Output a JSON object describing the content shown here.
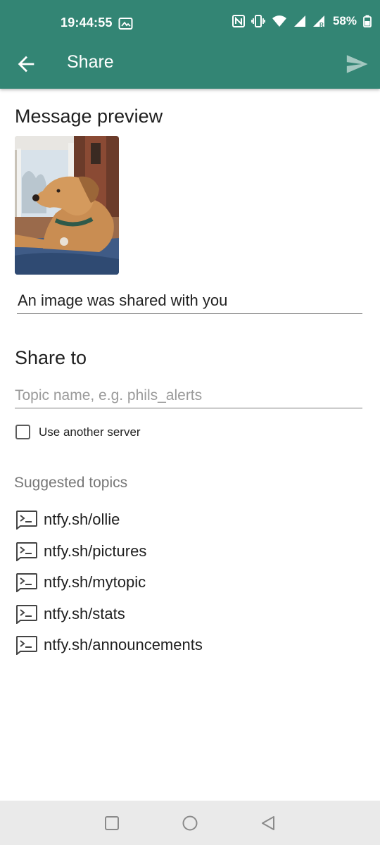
{
  "status_bar": {
    "time": "19:44:55",
    "battery": "58%",
    "icons": [
      "gallery-icon",
      "nfc-icon",
      "vibrate-icon",
      "wifi-icon",
      "signal-icon",
      "signal-roaming-icon",
      "battery-icon"
    ]
  },
  "app_bar": {
    "title": "Share",
    "back_icon": "arrow-back-icon",
    "send_icon": "send-icon",
    "background": "#338574"
  },
  "message_preview": {
    "heading": "Message preview",
    "image": "shared dog photo",
    "message": "An image was shared with you"
  },
  "share_to": {
    "heading": "Share to",
    "topic_placeholder": "Topic name, e.g. phils_alerts",
    "use_another_server_label": "Use another server",
    "use_another_server_checked": false
  },
  "suggested": {
    "heading": "Suggested topics",
    "topics": [
      {
        "label": "ntfy.sh/ollie",
        "icon": "terminal-icon"
      },
      {
        "label": "ntfy.sh/pictures",
        "icon": "terminal-icon"
      },
      {
        "label": "ntfy.sh/mytopic",
        "icon": "terminal-icon"
      },
      {
        "label": "ntfy.sh/stats",
        "icon": "terminal-icon"
      },
      {
        "label": "ntfy.sh/announcements",
        "icon": "terminal-icon"
      }
    ]
  },
  "nav_bar": {
    "buttons": [
      "recents-square-icon",
      "home-circle-icon",
      "back-triangle-icon"
    ]
  }
}
